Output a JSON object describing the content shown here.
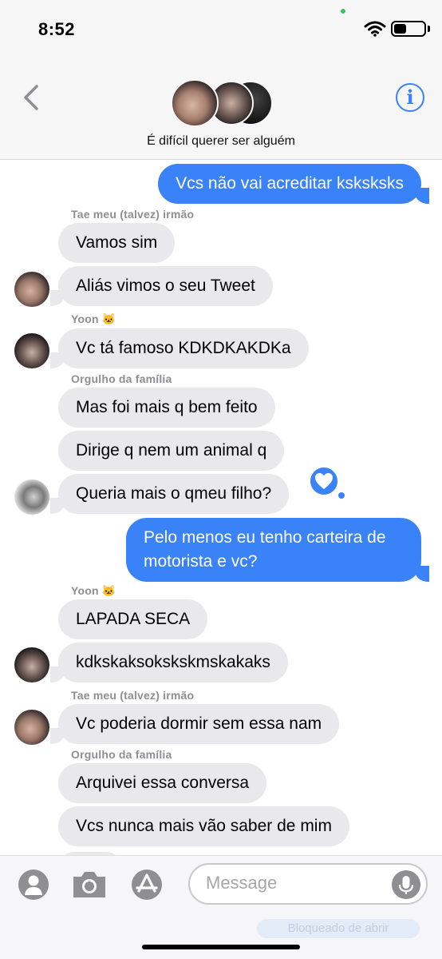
{
  "status_bar": {
    "time": "8:52",
    "battery_level": 0.42
  },
  "header": {
    "group_name": "É difícil querer ser alguém",
    "back_icon": "chevron-left-icon",
    "info_label": "i"
  },
  "messages": [
    {
      "type": "outgoing",
      "text": "Vcs não vai acreditar ksksksks"
    },
    {
      "type": "sender",
      "text": "Tae meu (talvez) irmão"
    },
    {
      "type": "incoming",
      "text": "Vamos sim"
    },
    {
      "type": "incoming",
      "text": "Aliás vimos o seu Tweet"
    },
    {
      "type": "sender",
      "text": "Yoon 🐱"
    },
    {
      "type": "incoming",
      "text": "Vc tá famoso KDKDKAKDKa"
    },
    {
      "type": "sender",
      "text": "Orgulho da família"
    },
    {
      "type": "incoming",
      "text": "Mas foi mais q bem feito"
    },
    {
      "type": "incoming",
      "text": "Dirige q nem um animal q"
    },
    {
      "type": "incoming",
      "text": "Queria mais o qmeu filho?",
      "reaction": "heart"
    },
    {
      "type": "outgoing",
      "text": "Pelo menos eu tenho carteira de motorista e vc?"
    },
    {
      "type": "sender",
      "text": "Yoon 🐱"
    },
    {
      "type": "incoming",
      "text": "LAPADA SECA"
    },
    {
      "type": "incoming",
      "text": "kdkskaksokskskmskakaks"
    },
    {
      "type": "sender",
      "text": "Tae meu (talvez) irmão"
    },
    {
      "type": "incoming",
      "text": "Vc poderia dormir sem essa nam"
    },
    {
      "type": "sender",
      "text": "Orgulho da família"
    },
    {
      "type": "incoming",
      "text": "Arquivei essa conversa"
    },
    {
      "type": "incoming",
      "text": "Vcs nunca mais vão saber de mim"
    }
  ],
  "input_bar": {
    "placeholder": "Message",
    "icons": [
      "memoji-icon",
      "camera-icon",
      "app-store-icon",
      "microphone-icon"
    ],
    "ghost_text": "Bloqueado de abrir"
  },
  "colors": {
    "outgoing": "#3a82f7",
    "incoming": "#e9e9eb",
    "sender_label": "#8e8e93"
  }
}
